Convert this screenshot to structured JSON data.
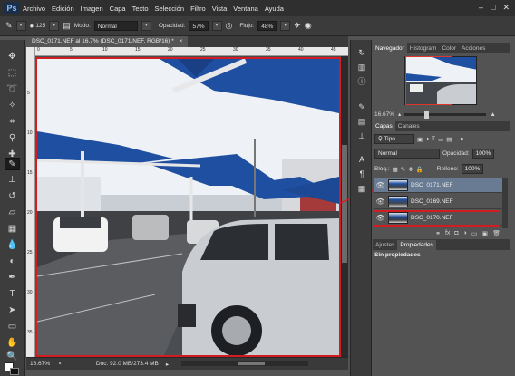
{
  "app": {
    "logo": "Ps"
  },
  "menubar": {
    "items": [
      "Archivo",
      "Edición",
      "Imagen",
      "Capa",
      "Texto",
      "Selección",
      "Filtro",
      "Vista",
      "Ventana",
      "Ayuda"
    ],
    "window_controls": [
      "–",
      "□",
      "✕"
    ]
  },
  "options": {
    "brush_size": "125",
    "mode_label": "Modo:",
    "mode_value": "Normal",
    "opacity_label": "Opacidad:",
    "opacity_value": "57%",
    "flow_label": "Flujo:",
    "flow_value": "48%"
  },
  "document": {
    "tab_title": "DSC_0171.NEF al 16.7% (DSC_0171.NEF, RGB/16) *",
    "tab_close": "×",
    "ruler_top_ticks": [
      "0",
      "5",
      "10",
      "15",
      "20",
      "25",
      "30",
      "35",
      "40",
      "45"
    ],
    "ruler_left_ticks": [
      "5",
      "10",
      "15",
      "20",
      "25",
      "30",
      "35"
    ],
    "status_zoom": "16.67%",
    "status_doc": "Doc: 92.0 MB/273.4 MB"
  },
  "navigator": {
    "tabs": [
      "Navegador",
      "Histogram",
      "Color",
      "Acciones"
    ],
    "zoom": "16.67%"
  },
  "layers_panel": {
    "tabs": [
      "Capas",
      "Canales"
    ],
    "filter_value": "Tipo",
    "blend_mode": "Normal",
    "opacity_label": "Opacidad:",
    "opacity_value": "100%",
    "lock_label": "Bloq.:",
    "fill_label": "Relleno:",
    "fill_value": "100%",
    "layers": [
      {
        "name": "DSC_0171.NEF",
        "selected": true
      },
      {
        "name": "DSC_0169.NEF",
        "selected": false
      },
      {
        "name": "DSC_0170.NEF",
        "selected": false
      }
    ],
    "footer_icons": [
      "⚭",
      "fx",
      "◘",
      "◑",
      "▭",
      "▣",
      "🗑"
    ]
  },
  "properties_panel": {
    "tabs": [
      "Ajustes",
      "Propiedades"
    ],
    "body_text": "Sin propiedades"
  },
  "colors": {
    "highlight_red": "#d11d22",
    "sky": "#f0f3f7",
    "canopy_blue": "#1f4fa0"
  }
}
